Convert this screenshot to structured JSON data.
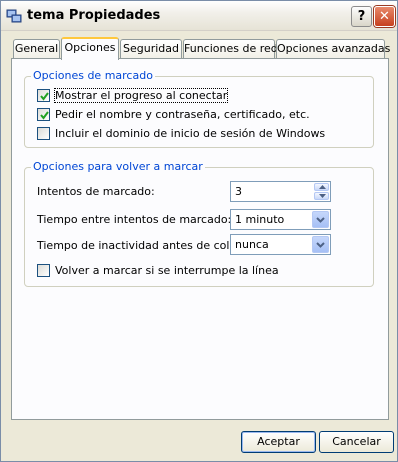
{
  "window": {
    "title": "tema Propiedades",
    "icons": {
      "app": "network-connection-icon",
      "help": "help-icon",
      "close": "close-icon"
    },
    "help_glyph": "?",
    "close_glyph": "✕"
  },
  "tabs": [
    {
      "label": "General",
      "active": false
    },
    {
      "label": "Opciones",
      "active": true
    },
    {
      "label": "Seguridad",
      "active": false
    },
    {
      "label": "Funciones de red",
      "active": false
    },
    {
      "label": "Opciones avanzadas",
      "active": false
    }
  ],
  "dialing_options": {
    "legend": "Opciones de marcado",
    "items": [
      {
        "label": "Mostrar el progreso al conectar",
        "checked": true
      },
      {
        "label": "Pedir el nombre y contraseña, certificado, etc.",
        "checked": true
      },
      {
        "label": "Incluir el dominio de inicio de sesión de Windows",
        "checked": false
      }
    ]
  },
  "redial_options": {
    "legend": "Opciones para volver a marcar",
    "attempts_label": "Intentos de marcado:",
    "attempts_value": "3",
    "interval_label": "Tiempo entre intentos de marcado:",
    "interval_value": "1 minuto",
    "idle_label": "Tiempo de inactividad antes de colgar:",
    "idle_value": "nunca",
    "redial_on_drop_label": "Volver a marcar si se interrumpe la línea",
    "redial_on_drop_checked": false
  },
  "buttons": {
    "ok": "Aceptar",
    "cancel": "Cancelar"
  },
  "colors": {
    "legend": "#0046d5",
    "active_tab_highlight": "#ffc83c",
    "close_button": "#c6401f",
    "check": "#21a121"
  }
}
